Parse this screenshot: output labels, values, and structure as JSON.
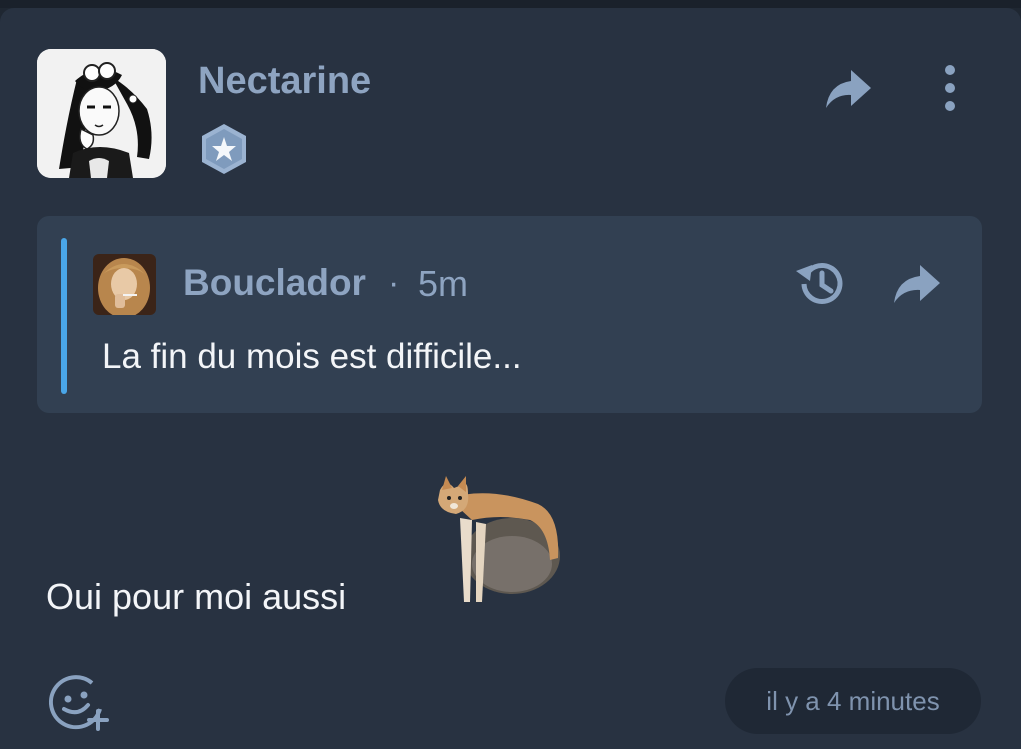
{
  "post": {
    "author": "Nectarine",
    "avatar_icon": "manga-girl-avatar",
    "badge_icon": "star-badge-icon",
    "reply_text": "Oui pour moi aussi",
    "sticker": "cat-sitting-on-rock-sticker",
    "timestamp": "il y a 4 minutes"
  },
  "quote": {
    "author": "Bouclador",
    "separator": "·",
    "time": "5m",
    "text": "La fin du mois est difficile...",
    "avatar_icon": "user-photo-avatar"
  },
  "colors": {
    "background": "#283241",
    "quote_background": "#324052",
    "quote_accent": "#4aa6e8",
    "name": "#8ea4c1",
    "text": "#f3f5f8",
    "badge": "#9bb3d1"
  }
}
